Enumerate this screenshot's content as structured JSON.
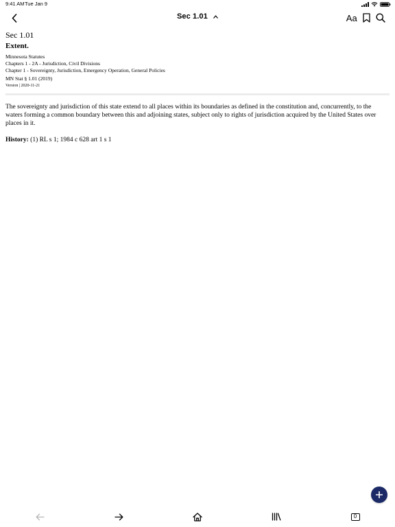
{
  "status_bar": {
    "time": "9:41 AM",
    "date": "Tue Jan 9",
    "icons": [
      "cellular-signal-icon",
      "wifi-icon",
      "battery-icon"
    ]
  },
  "nav": {
    "title": "Sec 1.01",
    "font_button_label": "Aa",
    "icons": [
      "back-chevron-icon",
      "chevron-up-icon",
      "bookmark-icon",
      "search-icon"
    ]
  },
  "document": {
    "section_number": "Sec 1.01",
    "section_heading": "Extent.",
    "meta_lines": [
      "Minnesota Statutes",
      "Chapters 1 - 2A - Jurisdiction, Civil Divisions",
      "Chapter 1 - Sovereignty, Jurisdiction, Emergency Operation, General Policies",
      "MN Stat § 1.01 (2019)"
    ],
    "version": "Version | 2020-11-21",
    "body": "The sovereignty and jurisdiction of this state extend to all places within its boundaries as defined in the constitution and, concurrently, to the waters forming a common boundary between this and adjoining states, subject only to rights of jurisdiction acquired by the United States over places in it.",
    "history_label": "History:",
    "history_text": " (1) RL s 1; 1984 c 628 art 1 s 1"
  },
  "toolbar": {
    "tabs_count": "0",
    "icons": [
      "arrow-left-icon",
      "arrow-right-icon",
      "home-icon",
      "library-icon",
      "tabs-icon",
      "plus-icon"
    ]
  },
  "colors": {
    "accent": "#1b2a66",
    "disabled": "#b5b5b5",
    "divider": "#ececec"
  }
}
